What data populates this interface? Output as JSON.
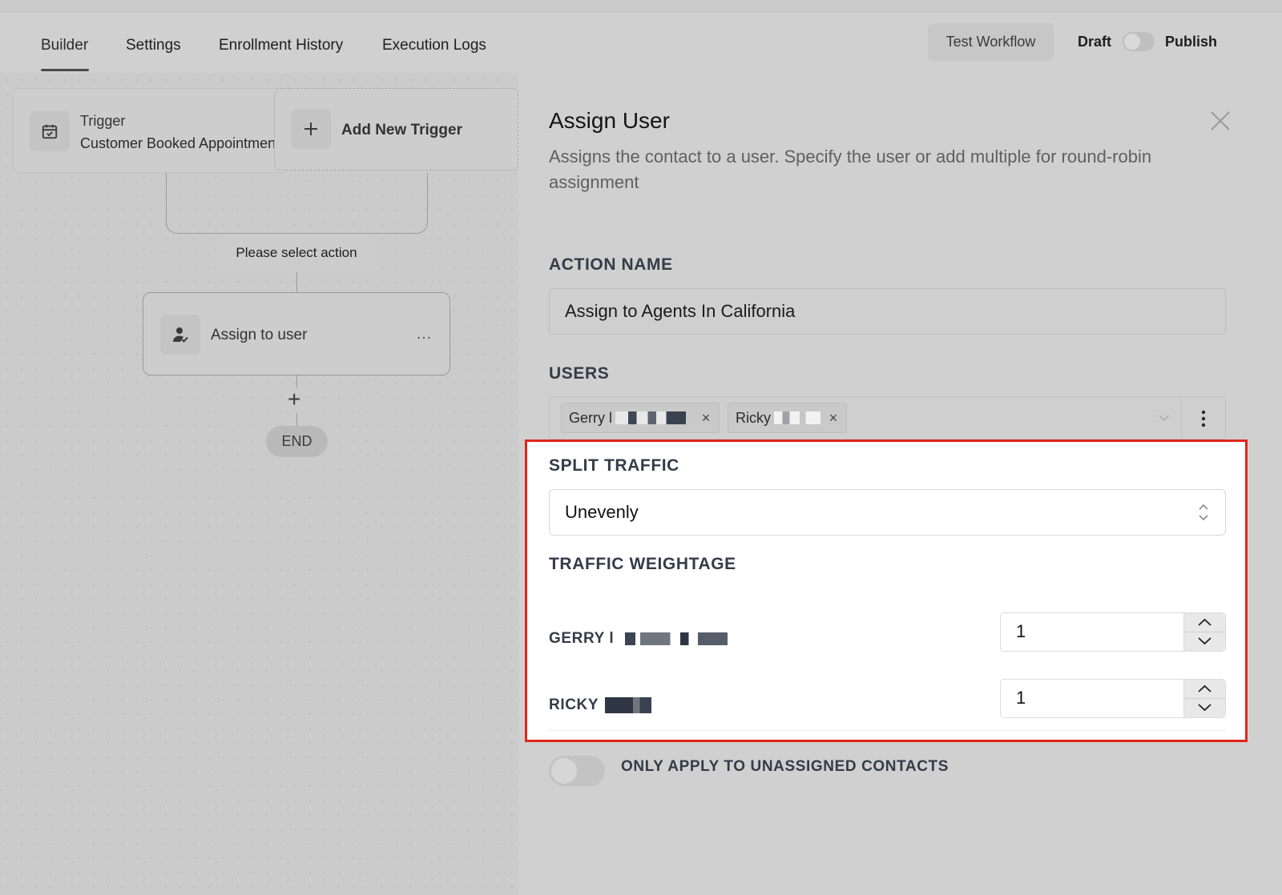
{
  "tabs": [
    {
      "label": "Builder",
      "active": true
    },
    {
      "label": "Settings",
      "active": false
    },
    {
      "label": "Enrollment History",
      "active": false
    },
    {
      "label": "Execution Logs",
      "active": false
    }
  ],
  "header": {
    "test_button": "Test Workflow",
    "draft_label": "Draft",
    "publish_label": "Publish",
    "publish_toggle_on": false
  },
  "canvas": {
    "trigger": {
      "title": "Trigger",
      "subtitle": "Customer Booked Appointment",
      "icon": "calendar-check-icon"
    },
    "add_trigger": {
      "label": "Add New Trigger",
      "icon": "plus-icon"
    },
    "select_action": "Please select action",
    "action": {
      "label": "Assign to user",
      "menu_glyph": "…",
      "icon": "assign-user-icon"
    },
    "add_glyph": "+",
    "end_label": "END"
  },
  "panel": {
    "title": "Assign User",
    "description": "Assigns the contact to a user. Specify the user or add multiple for round-robin assignment",
    "action_name_label": "ACTION NAME",
    "action_name_value": "Assign to Agents In California",
    "users_label": "USERS",
    "users": [
      {
        "name": "Gerry l",
        "remove_glyph": "×"
      },
      {
        "name": "Ricky",
        "remove_glyph": "×"
      }
    ],
    "split_traffic_label": "SPLIT TRAFFIC",
    "split_traffic_value": "Unevenly",
    "traffic_weightage_label": "TRAFFIC WEIGHTAGE",
    "weights": [
      {
        "name": "GERRY l",
        "value": "1"
      },
      {
        "name": "RICKY",
        "value": "1"
      }
    ],
    "unassigned_toggle_label": "ONLY APPLY TO UNASSIGNED CONTACTS",
    "unassigned_toggle_on": false
  },
  "colors": {
    "highlight_border": "#e0251b",
    "dim_overlay": "#cfcfcf"
  }
}
